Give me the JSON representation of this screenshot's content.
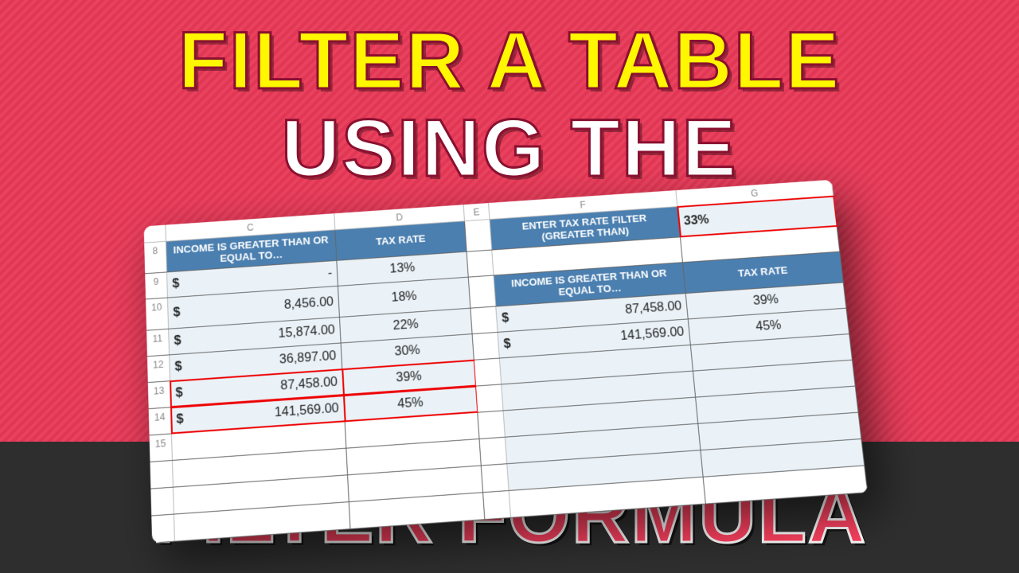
{
  "title": {
    "line1": "FILTER A TABLE",
    "line2": "USING THE",
    "line3": "FILTER FORMULA"
  },
  "columns": {
    "c": "C",
    "d": "D",
    "e": "E",
    "f": "F",
    "g": "G"
  },
  "rowNums": {
    "r8": "8",
    "r9": "9",
    "r10": "10",
    "r11": "11",
    "r12": "12",
    "r13": "13",
    "r14": "14",
    "r15": "15"
  },
  "leftTable": {
    "hdr1": "INCOME IS GREATER THAN OR EQUAL TO…",
    "hdr2": "TAX RATE",
    "rows": [
      {
        "inc": "-",
        "rate": "13%"
      },
      {
        "inc": "8,456.00",
        "rate": "18%"
      },
      {
        "inc": "15,874.00",
        "rate": "22%"
      },
      {
        "inc": "36,897.00",
        "rate": "30%"
      },
      {
        "inc": "87,458.00",
        "rate": "39%"
      },
      {
        "inc": "141,569.00",
        "rate": "45%"
      }
    ]
  },
  "filterLabel": "ENTER TAX RATE FILTER (GREATER THAN)",
  "filterValue": "33%",
  "rightTable": {
    "hdr1": "INCOME IS GREATER THAN OR EQUAL TO…",
    "hdr2": "TAX RATE",
    "rows": [
      {
        "inc": "87,458.00",
        "rate": "39%"
      },
      {
        "inc": "141,569.00",
        "rate": "45%"
      }
    ]
  },
  "dollar": "$"
}
